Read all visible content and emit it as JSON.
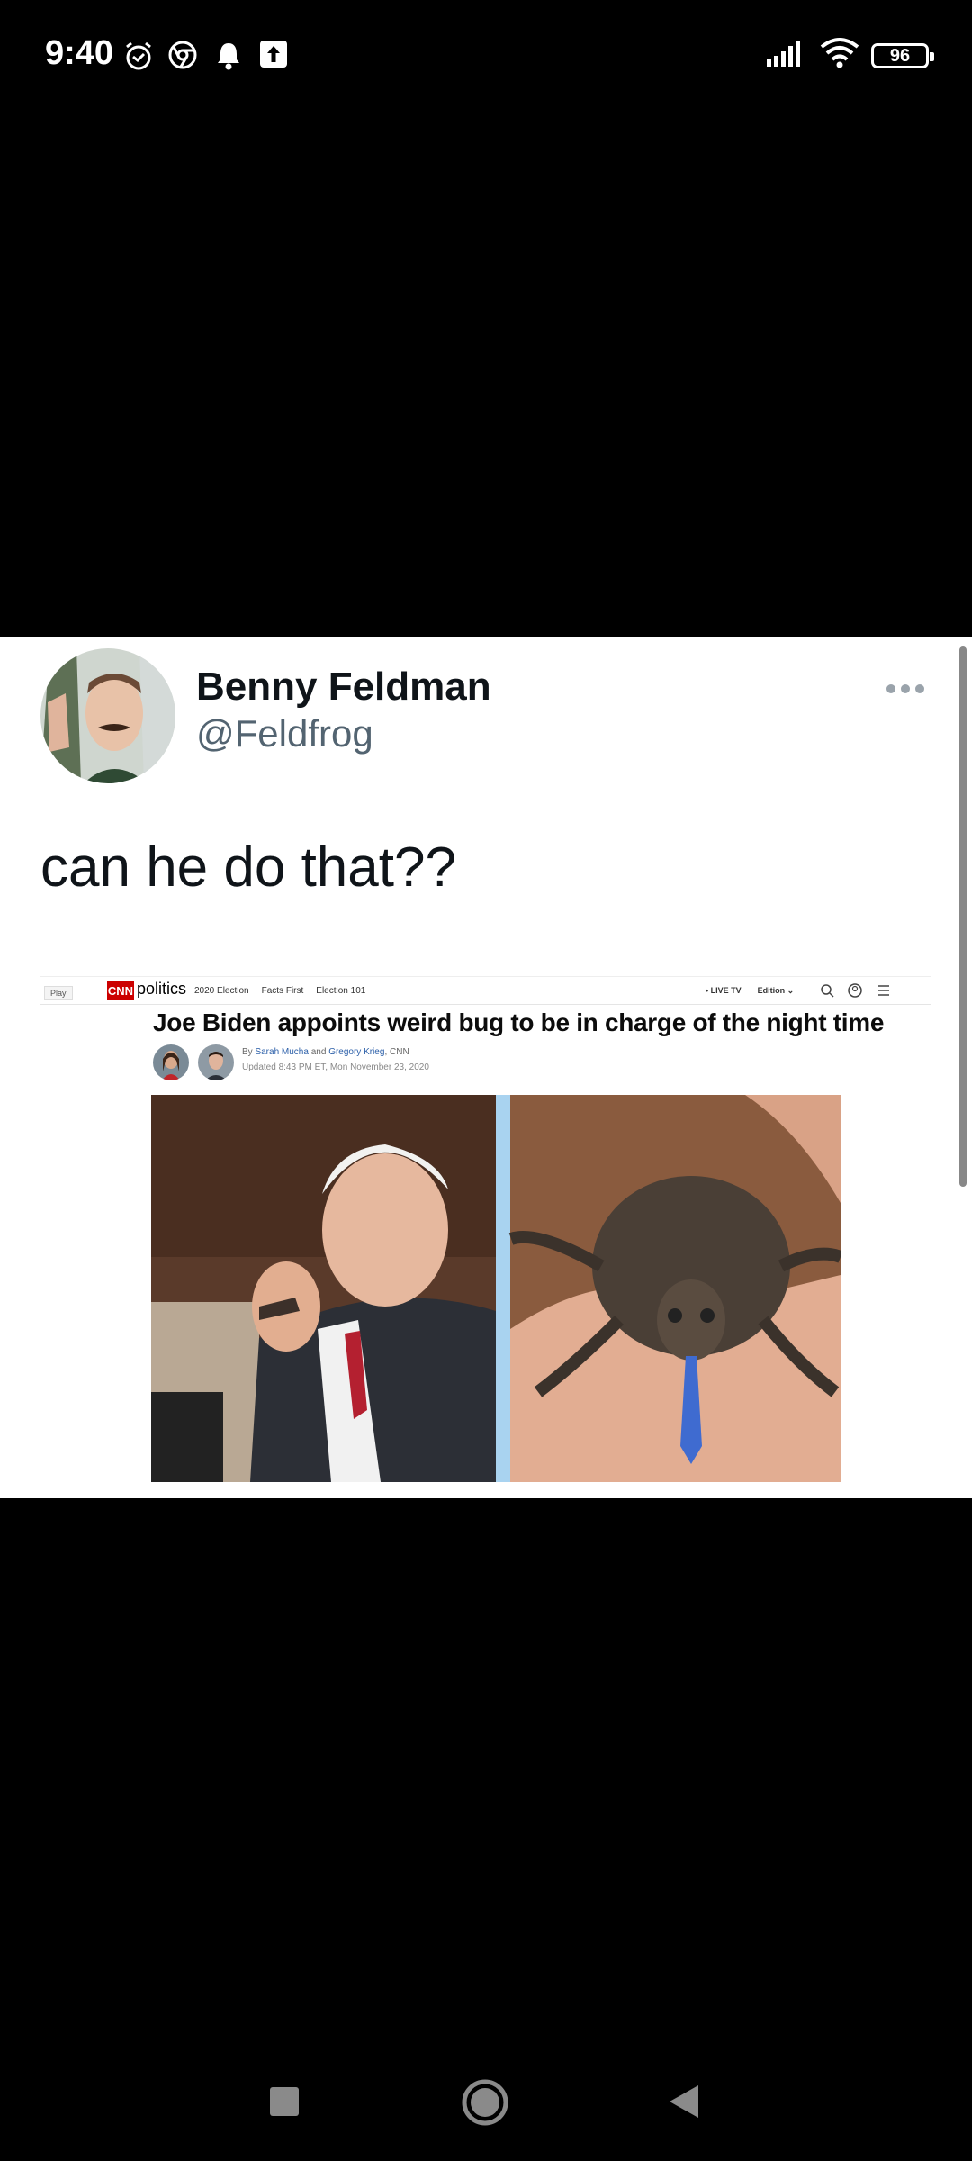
{
  "status_bar": {
    "time": "9:40",
    "battery": "96",
    "icons": [
      "alarm-icon",
      "chrome-icon",
      "notification-bell-icon",
      "upload-icon",
      "signal-icon",
      "wifi-icon",
      "battery-icon"
    ]
  },
  "tweet": {
    "display_name": "Benny Feldman",
    "handle": "@Feldfrog",
    "text": "can he do that??"
  },
  "embedded_article": {
    "play_label": "Play",
    "logo": "CNN",
    "section": "politics",
    "nav_links": [
      "2020 Election",
      "Facts First",
      "Election 101"
    ],
    "live_tv": "• LIVE TV",
    "edition": "Edition ⌄",
    "headline": "Joe Biden appoints weird bug to be in charge of the night time",
    "byline_prefix": "By ",
    "author1": "Sarah Mucha",
    "byline_and": " and ",
    "author2": "Gregory Krieg",
    "byline_suffix": ", CNN",
    "updated": "Updated 8:43 PM ET, Mon November 23, 2020"
  },
  "colors": {
    "cnn_red": "#cc0000",
    "link_blue": "#2a5ea8",
    "handle_gray": "#536471"
  }
}
